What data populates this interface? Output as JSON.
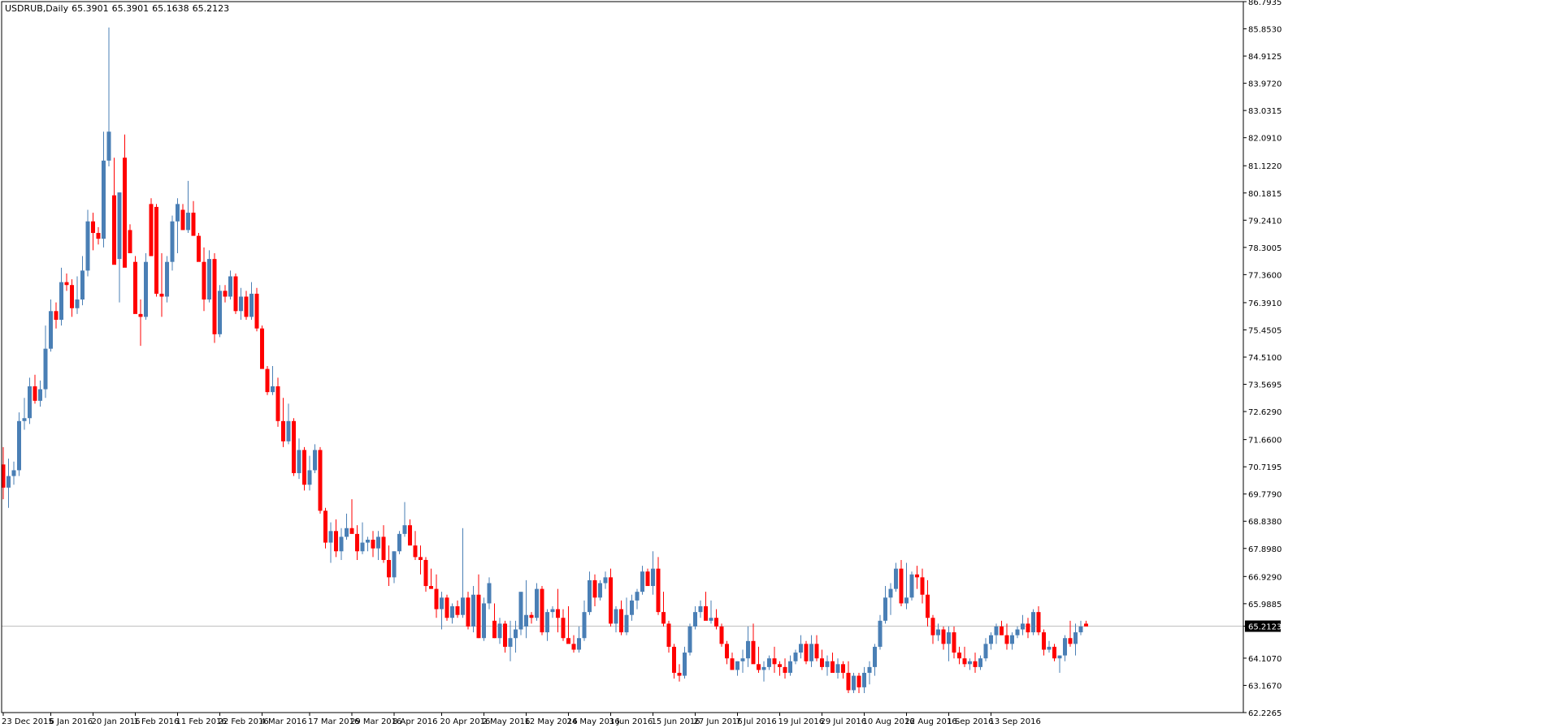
{
  "header": {
    "symbol": "USDRUB,Daily",
    "open": "65.3901",
    "high": "65.3901",
    "low": "65.1638",
    "close": "65.2123"
  },
  "colors": {
    "bull": "#4a7fb5",
    "bear": "#ff0000",
    "price_line": "#c0c0c0",
    "price_tag_bg": "#000000",
    "price_tag_fg": "#ffffff",
    "axis": "#000000",
    "background": "#ffffff"
  },
  "chart_data": {
    "type": "candlestick",
    "symbol": "USDRUB",
    "timeframe": "Daily",
    "current_price": "65.2123",
    "ylim": [
      62.2265,
      86.7935
    ],
    "y_ticks": [
      "86.7935",
      "85.8530",
      "84.9125",
      "83.9720",
      "83.0315",
      "82.0910",
      "81.1220",
      "80.1815",
      "79.2410",
      "78.3005",
      "77.3600",
      "76.3910",
      "75.4505",
      "74.5100",
      "73.5695",
      "72.6290",
      "71.6600",
      "70.7195",
      "69.7790",
      "68.8380",
      "67.8980",
      "66.9290",
      "65.9885",
      "65.2123",
      "64.1070",
      "63.1670",
      "62.2265"
    ],
    "x_ticks": [
      {
        "i": 0,
        "label": "23 Dec 2015"
      },
      {
        "i": 9,
        "label": "6 Jan 2016"
      },
      {
        "i": 17,
        "label": "20 Jan 2016"
      },
      {
        "i": 25,
        "label": "1 Feb 2016"
      },
      {
        "i": 33,
        "label": "11 Feb 2016"
      },
      {
        "i": 41,
        "label": "22 Feb 2016"
      },
      {
        "i": 49,
        "label": "4 Mar 2016"
      },
      {
        "i": 58,
        "label": "17 Mar 2016"
      },
      {
        "i": 66,
        "label": "29 Mar 2016"
      },
      {
        "i": 74,
        "label": "8 Apr 2016"
      },
      {
        "i": 83,
        "label": "20 Apr 2016"
      },
      {
        "i": 91,
        "label": "2 May 2016"
      },
      {
        "i": 99,
        "label": "12 May 2016"
      },
      {
        "i": 107,
        "label": "24 May 2016"
      },
      {
        "i": 115,
        "label": "3 Jun 2016"
      },
      {
        "i": 123,
        "label": "15 Jun 2016"
      },
      {
        "i": 131,
        "label": "27 Jun 2016"
      },
      {
        "i": 139,
        "label": "7 Jul 2016"
      },
      {
        "i": 147,
        "label": "19 Jul 2016"
      },
      {
        "i": 155,
        "label": "29 Jul 2016"
      },
      {
        "i": 163,
        "label": "10 Aug 2016"
      },
      {
        "i": 171,
        "label": "22 Aug 2016"
      },
      {
        "i": 179,
        "label": "1 Sep 2016"
      },
      {
        "i": 187,
        "label": "13 Sep 2016"
      }
    ],
    "ohlc": [
      [
        70.8,
        71.4,
        69.6,
        70.0
      ],
      [
        70.0,
        71.0,
        69.3,
        70.4
      ],
      [
        70.4,
        70.9,
        70.1,
        70.6
      ],
      [
        70.6,
        72.6,
        70.4,
        72.3
      ],
      [
        72.3,
        73.1,
        72.0,
        72.4
      ],
      [
        72.4,
        73.8,
        72.2,
        73.5
      ],
      [
        73.5,
        73.9,
        72.9,
        73.0
      ],
      [
        73.0,
        73.7,
        72.8,
        73.4
      ],
      [
        73.4,
        75.6,
        73.1,
        74.8
      ],
      [
        74.8,
        76.5,
        74.7,
        76.1
      ],
      [
        76.1,
        76.4,
        75.5,
        75.8
      ],
      [
        75.8,
        77.6,
        75.6,
        77.1
      ],
      [
        77.1,
        77.4,
        76.8,
        77.0
      ],
      [
        77.0,
        77.2,
        75.9,
        76.2
      ],
      [
        76.2,
        77.3,
        76.0,
        76.5
      ],
      [
        76.5,
        78.0,
        76.3,
        77.5
      ],
      [
        77.5,
        79.6,
        77.3,
        79.2
      ],
      [
        79.2,
        79.5,
        78.2,
        78.8
      ],
      [
        78.8,
        79.0,
        78.4,
        78.6
      ],
      [
        78.6,
        82.3,
        78.3,
        81.3
      ],
      [
        81.3,
        85.9,
        81.1,
        82.3
      ],
      [
        80.1,
        81.4,
        77.9,
        77.7
      ],
      [
        77.9,
        80.2,
        76.4,
        80.2
      ],
      [
        81.4,
        82.2,
        77.7,
        77.6
      ],
      [
        78.9,
        79.1,
        78.1,
        78.1
      ],
      [
        77.8,
        78.0,
        76.1,
        76.0
      ],
      [
        76.0,
        76.5,
        74.9,
        75.9
      ],
      [
        75.9,
        78.1,
        75.8,
        77.8
      ],
      [
        79.8,
        80.0,
        78.0,
        78.0
      ],
      [
        79.7,
        79.8,
        76.6,
        76.7
      ],
      [
        76.7,
        78.1,
        75.9,
        76.6
      ],
      [
        76.6,
        78.0,
        76.4,
        77.8
      ],
      [
        77.8,
        79.4,
        77.5,
        79.2
      ],
      [
        79.2,
        80.0,
        78.1,
        79.8
      ],
      [
        79.6,
        79.8,
        79.0,
        78.9
      ],
      [
        78.9,
        80.6,
        78.8,
        79.5
      ],
      [
        79.5,
        79.9,
        79.0,
        78.7
      ],
      [
        78.7,
        78.8,
        78.1,
        77.8
      ],
      [
        77.8,
        78.3,
        76.1,
        76.5
      ],
      [
        76.5,
        78.2,
        76.4,
        77.9
      ],
      [
        77.9,
        78.1,
        75.0,
        75.3
      ],
      [
        75.3,
        77.0,
        75.2,
        76.8
      ],
      [
        76.8,
        77.0,
        76.4,
        76.6
      ],
      [
        76.6,
        77.5,
        76.5,
        77.3
      ],
      [
        77.3,
        77.4,
        76.0,
        76.1
      ],
      [
        76.1,
        76.9,
        75.8,
        76.6
      ],
      [
        76.6,
        76.8,
        75.8,
        75.9
      ],
      [
        75.9,
        77.1,
        75.8,
        76.7
      ],
      [
        76.7,
        76.9,
        75.4,
        75.5
      ],
      [
        75.5,
        75.6,
        74.9,
        74.1
      ],
      [
        74.1,
        74.2,
        73.2,
        73.3
      ],
      [
        73.3,
        74.2,
        73.2,
        73.5
      ],
      [
        73.5,
        73.8,
        72.1,
        72.3
      ],
      [
        72.3,
        73.1,
        71.4,
        71.6
      ],
      [
        71.6,
        72.9,
        71.5,
        72.3
      ],
      [
        72.3,
        72.4,
        70.4,
        70.5
      ],
      [
        70.5,
        71.7,
        70.3,
        71.3
      ],
      [
        71.3,
        71.4,
        69.9,
        70.1
      ],
      [
        70.1,
        71.1,
        69.9,
        70.6
      ],
      [
        70.6,
        71.5,
        70.5,
        71.3
      ],
      [
        71.3,
        71.4,
        69.1,
        69.2
      ],
      [
        69.2,
        69.3,
        67.9,
        68.1
      ],
      [
        68.1,
        68.8,
        67.4,
        68.5
      ],
      [
        68.5,
        68.9,
        67.6,
        67.8
      ],
      [
        67.8,
        68.6,
        67.5,
        68.3
      ],
      [
        68.3,
        69.1,
        68.2,
        68.6
      ],
      [
        68.6,
        69.6,
        68.5,
        68.4
      ],
      [
        68.4,
        68.7,
        67.5,
        67.8
      ],
      [
        67.8,
        68.8,
        67.7,
        68.1
      ],
      [
        68.1,
        68.3,
        67.8,
        68.2
      ],
      [
        68.2,
        68.5,
        67.6,
        67.9
      ],
      [
        67.9,
        68.5,
        67.5,
        68.3
      ],
      [
        68.3,
        68.7,
        67.4,
        67.5
      ],
      [
        67.5,
        68.0,
        66.6,
        66.9
      ],
      [
        66.9,
        67.8,
        66.7,
        67.8
      ],
      [
        67.8,
        68.5,
        67.7,
        68.4
      ],
      [
        68.4,
        69.5,
        68.3,
        68.7
      ],
      [
        68.7,
        68.9,
        68.0,
        68.0
      ],
      [
        68.0,
        68.5,
        67.5,
        67.6
      ],
      [
        67.6,
        68.0,
        67.0,
        67.5
      ],
      [
        67.5,
        67.6,
        66.4,
        66.6
      ],
      [
        66.6,
        67.2,
        66.5,
        66.5
      ],
      [
        66.5,
        67.0,
        65.5,
        65.8
      ],
      [
        65.8,
        66.4,
        65.1,
        66.2
      ],
      [
        66.2,
        66.3,
        65.4,
        65.5
      ],
      [
        65.5,
        66.0,
        65.3,
        65.9
      ],
      [
        65.9,
        66.1,
        65.5,
        65.6
      ],
      [
        65.6,
        68.6,
        65.5,
        66.2
      ],
      [
        66.2,
        66.4,
        65.1,
        65.2
      ],
      [
        65.2,
        66.6,
        65.0,
        66.3
      ],
      [
        66.3,
        67.0,
        64.8,
        64.8
      ],
      [
        64.8,
        66.2,
        64.7,
        66.0
      ],
      [
        66.0,
        66.9,
        65.8,
        66.7
      ],
      [
        65.4,
        66.0,
        64.8,
        64.8
      ],
      [
        64.8,
        65.5,
        64.6,
        65.3
      ],
      [
        65.3,
        65.4,
        64.3,
        64.5
      ],
      [
        64.5,
        65.4,
        64.0,
        64.8
      ],
      [
        64.8,
        65.4,
        64.3,
        65.1
      ],
      [
        65.1,
        66.0,
        64.9,
        66.4
      ],
      [
        65.2,
        66.8,
        64.8,
        65.6
      ],
      [
        65.6,
        65.7,
        65.3,
        65.5
      ],
      [
        65.5,
        66.7,
        65.4,
        66.5
      ],
      [
        66.5,
        66.6,
        64.9,
        65.0
      ],
      [
        65.0,
        65.8,
        64.7,
        65.7
      ],
      [
        65.7,
        65.9,
        65.5,
        65.8
      ],
      [
        65.8,
        66.5,
        65.0,
        65.5
      ],
      [
        65.5,
        65.8,
        64.7,
        64.8
      ],
      [
        64.8,
        65.9,
        64.7,
        64.6
      ],
      [
        64.6,
        64.9,
        64.3,
        64.4
      ],
      [
        64.4,
        65.2,
        64.3,
        64.8
      ],
      [
        64.8,
        66.1,
        64.7,
        65.7
      ],
      [
        65.7,
        67.1,
        65.6,
        66.8
      ],
      [
        66.8,
        67.0,
        65.9,
        66.2
      ],
      [
        66.2,
        66.8,
        66.1,
        66.7
      ],
      [
        66.7,
        67.1,
        66.5,
        66.9
      ],
      [
        66.9,
        67.2,
        65.2,
        65.3
      ],
      [
        65.3,
        65.9,
        65.0,
        65.8
      ],
      [
        65.8,
        66.1,
        64.9,
        65.0
      ],
      [
        65.0,
        66.2,
        64.9,
        65.6
      ],
      [
        65.6,
        66.3,
        65.4,
        66.1
      ],
      [
        66.1,
        66.5,
        65.8,
        66.4
      ],
      [
        66.4,
        67.3,
        66.3,
        67.1
      ],
      [
        67.1,
        67.2,
        66.9,
        66.6
      ],
      [
        66.6,
        67.8,
        66.3,
        67.2
      ],
      [
        67.2,
        67.6,
        65.6,
        65.7
      ],
      [
        65.7,
        66.4,
        65.2,
        65.3
      ],
      [
        65.3,
        65.4,
        64.3,
        64.5
      ],
      [
        64.5,
        64.6,
        63.4,
        63.6
      ],
      [
        63.6,
        63.9,
        63.3,
        63.5
      ],
      [
        63.5,
        64.5,
        63.4,
        64.3
      ],
      [
        64.3,
        65.3,
        64.2,
        65.2
      ],
      [
        65.2,
        65.9,
        65.1,
        65.7
      ],
      [
        65.7,
        66.1,
        65.5,
        65.9
      ],
      [
        65.9,
        66.4,
        65.6,
        65.4
      ],
      [
        65.4,
        66.1,
        65.3,
        65.5
      ],
      [
        65.5,
        65.8,
        65.1,
        65.2
      ],
      [
        65.2,
        65.3,
        64.5,
        64.6
      ],
      [
        64.6,
        64.7,
        63.9,
        64.1
      ],
      [
        64.1,
        64.3,
        63.8,
        63.7
      ],
      [
        63.7,
        64.0,
        63.5,
        64.0
      ],
      [
        64.0,
        64.4,
        63.6,
        64.1
      ],
      [
        64.1,
        65.2,
        63.8,
        64.7
      ],
      [
        64.7,
        65.3,
        64.4,
        63.9
      ],
      [
        63.9,
        64.5,
        63.6,
        63.7
      ],
      [
        63.7,
        64.0,
        63.3,
        63.8
      ],
      [
        63.8,
        64.2,
        63.7,
        64.1
      ],
      [
        64.1,
        64.5,
        63.6,
        63.9
      ],
      [
        63.9,
        64.0,
        63.5,
        63.8
      ],
      [
        63.8,
        64.1,
        63.4,
        63.6
      ],
      [
        63.6,
        64.2,
        63.5,
        64.0
      ],
      [
        64.0,
        64.4,
        63.9,
        64.3
      ],
      [
        64.3,
        64.9,
        64.1,
        64.6
      ],
      [
        64.6,
        64.7,
        63.9,
        64.0
      ],
      [
        64.0,
        64.9,
        63.8,
        64.6
      ],
      [
        64.6,
        64.9,
        64.0,
        64.1
      ],
      [
        64.1,
        64.4,
        63.7,
        63.8
      ],
      [
        63.8,
        64.2,
        63.5,
        64.0
      ],
      [
        64.0,
        64.3,
        63.6,
        63.6
      ],
      [
        63.6,
        64.1,
        63.4,
        63.9
      ],
      [
        63.9,
        64.0,
        63.4,
        63.6
      ],
      [
        63.6,
        64.0,
        62.9,
        63.0
      ],
      [
        63.0,
        63.6,
        62.9,
        63.5
      ],
      [
        63.5,
        63.6,
        62.9,
        63.1
      ],
      [
        63.1,
        63.8,
        62.9,
        63.6
      ],
      [
        63.6,
        64.0,
        63.2,
        63.8
      ],
      [
        63.8,
        64.6,
        63.5,
        64.5
      ],
      [
        64.5,
        65.6,
        64.4,
        65.4
      ],
      [
        65.4,
        66.6,
        65.3,
        66.2
      ],
      [
        66.2,
        66.7,
        65.6,
        66.5
      ],
      [
        66.5,
        67.4,
        66.4,
        67.2
      ],
      [
        67.2,
        67.5,
        65.9,
        66.0
      ],
      [
        66.0,
        67.4,
        65.8,
        66.2
      ],
      [
        66.2,
        67.1,
        66.1,
        67.0
      ],
      [
        67.0,
        67.3,
        66.5,
        66.9
      ],
      [
        66.9,
        67.2,
        66.0,
        66.3
      ],
      [
        66.3,
        66.8,
        65.2,
        65.5
      ],
      [
        65.5,
        65.6,
        64.6,
        64.9
      ],
      [
        64.9,
        65.3,
        64.7,
        65.1
      ],
      [
        65.1,
        65.2,
        64.4,
        64.6
      ],
      [
        64.6,
        65.2,
        64.0,
        65.0
      ],
      [
        65.0,
        65.2,
        64.1,
        64.3
      ],
      [
        64.3,
        64.5,
        63.9,
        64.1
      ],
      [
        64.1,
        64.5,
        63.8,
        63.9
      ],
      [
        63.9,
        64.1,
        63.7,
        64.0
      ],
      [
        64.0,
        64.3,
        63.6,
        63.8
      ],
      [
        63.8,
        64.2,
        63.7,
        64.1
      ],
      [
        64.1,
        64.8,
        64.0,
        64.6
      ],
      [
        64.6,
        65.0,
        64.4,
        64.9
      ],
      [
        64.9,
        65.3,
        64.6,
        65.2
      ],
      [
        65.2,
        65.4,
        64.9,
        64.9
      ],
      [
        64.9,
        65.3,
        64.4,
        64.6
      ],
      [
        64.6,
        65.0,
        64.4,
        64.9
      ],
      [
        64.9,
        65.2,
        64.8,
        65.1
      ],
      [
        65.1,
        65.6,
        64.9,
        65.3
      ],
      [
        65.3,
        65.5,
        64.8,
        65.0
      ],
      [
        65.0,
        65.8,
        64.9,
        65.7
      ],
      [
        65.7,
        65.9,
        64.9,
        65.0
      ],
      [
        65.0,
        65.1,
        64.2,
        64.4
      ],
      [
        64.4,
        64.7,
        64.3,
        64.5
      ],
      [
        64.5,
        64.6,
        64.0,
        64.1
      ],
      [
        64.1,
        64.2,
        63.6,
        64.2
      ],
      [
        64.2,
        64.9,
        64.0,
        64.8
      ],
      [
        64.8,
        65.4,
        64.5,
        64.6
      ],
      [
        64.6,
        65.3,
        64.2,
        65.0
      ],
      [
        65.0,
        65.4,
        64.9,
        65.2
      ],
      [
        65.3,
        65.4,
        65.2,
        65.2
      ]
    ]
  }
}
